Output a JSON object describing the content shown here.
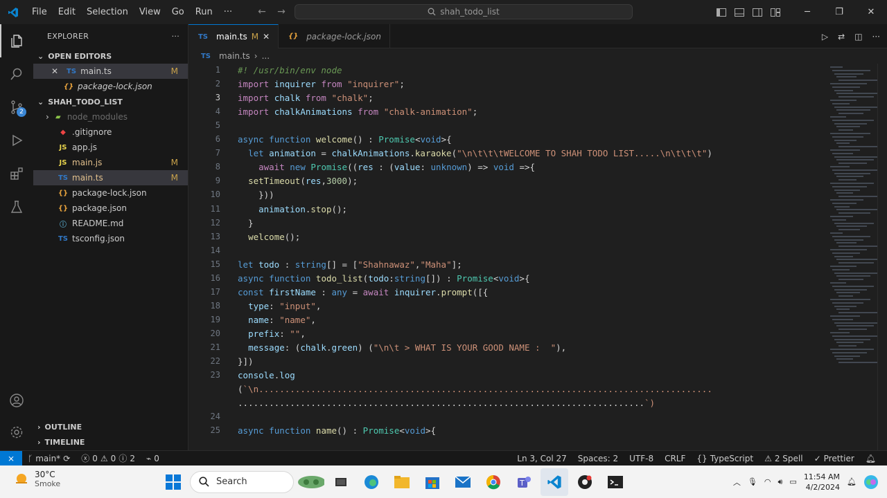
{
  "titlebar": {
    "menus": [
      "File",
      "Edit",
      "Selection",
      "View",
      "Go",
      "Run",
      "···"
    ],
    "search_text": "shah_todo_list"
  },
  "sidebar": {
    "header": "EXPLORER",
    "open_editors_label": "OPEN EDITORS",
    "open_editors": [
      {
        "name": "main.ts",
        "badge": "M",
        "icon": "TS"
      },
      {
        "name": "package-lock.json",
        "badge": "",
        "icon": ""
      }
    ],
    "project_label": "SHAH_TODO_LIST",
    "files": [
      {
        "name": "node_modules",
        "badge": "",
        "icon": "folder"
      },
      {
        "name": ".gitignore",
        "badge": "",
        "icon": "git"
      },
      {
        "name": "app.js",
        "badge": "",
        "icon": "JS"
      },
      {
        "name": "main.js",
        "badge": "M",
        "icon": "JS"
      },
      {
        "name": "main.ts",
        "badge": "M",
        "icon": "TS"
      },
      {
        "name": "package-lock.json",
        "badge": "",
        "icon": "json"
      },
      {
        "name": "package.json",
        "badge": "",
        "icon": "json"
      },
      {
        "name": "README.md",
        "badge": "",
        "icon": "md"
      },
      {
        "name": "tsconfig.json",
        "badge": "",
        "icon": "TS"
      }
    ],
    "outline_label": "OUTLINE",
    "timeline_label": "TIMELINE"
  },
  "tabs": [
    {
      "label": "main.ts",
      "badge": "M",
      "icon": "TS",
      "active": true
    },
    {
      "label": "package-lock.json",
      "badge": "",
      "icon": "json",
      "active": false
    }
  ],
  "breadcrumb": {
    "file": "main.ts",
    "rest": "..."
  },
  "code_lines": [
    {
      "n": "1",
      "text": "#! /usr/bin/env node"
    },
    {
      "n": "2",
      "text": "import inquirer from \"inquirer\";"
    },
    {
      "n": "3",
      "text": "import chalk from \"chalk\";"
    },
    {
      "n": "4",
      "text": "import chalkAnimations from \"chalk-animation\";"
    },
    {
      "n": "5",
      "text": ""
    },
    {
      "n": "6",
      "text": "async function welcome() : Promise<void>{"
    },
    {
      "n": "7",
      "text": "  let animation = chalkAnimations.karaoke(\"\\n\\t\\t\\tWELCOME TO SHAH TODO LIST.....\\n\\t\\t\\t\")"
    },
    {
      "n": "8",
      "text": "    await new Promise((res : (value: unknown) => void =>{"
    },
    {
      "n": "9",
      "text": "  setTimeout(res,3000);"
    },
    {
      "n": "10",
      "text": "    }))"
    },
    {
      "n": "11",
      "text": "    animation.stop();"
    },
    {
      "n": "12",
      "text": "  }"
    },
    {
      "n": "13",
      "text": "  welcome();"
    },
    {
      "n": "14",
      "text": ""
    },
    {
      "n": "15",
      "text": "let todo : string[] = [\"Shahnawaz\",\"Maha\"];"
    },
    {
      "n": "16",
      "text": "async function todo_list(todo:string[]) : Promise<void>{"
    },
    {
      "n": "17",
      "text": "const firstName : any = await inquirer.prompt([{"
    },
    {
      "n": "18",
      "text": "  type: \"input\","
    },
    {
      "n": "19",
      "text": "  name: \"name\","
    },
    {
      "n": "20",
      "text": "  prefix: \"\","
    },
    {
      "n": "21",
      "text": "  message: (chalk.green) (\"\\n\\t > WHAT IS YOUR GOOD NAME :  \"),"
    },
    {
      "n": "22",
      "text": "}])"
    },
    {
      "n": "23",
      "text": "console.log"
    },
    {
      "n": "",
      "text": "(`\\n......................................................................................."
    },
    {
      "n": "",
      "text": "..............................................................................`)"
    },
    {
      "n": "24",
      "text": ""
    },
    {
      "n": "25",
      "text": "async function name() : Promise<void>{"
    }
  ],
  "status": {
    "branch": "main*",
    "problems": "0",
    "warnings": "0",
    "info": "2",
    "ports": "0",
    "position": "Ln 3, Col 27",
    "spaces": "Spaces: 2",
    "encoding": "UTF-8",
    "eol": "CRLF",
    "language": "TypeScript",
    "spell": "2 Spell",
    "formatter": "Prettier"
  },
  "taskbar": {
    "temp": "30°C",
    "weather": "Smoke",
    "search": "Search",
    "time": "11:54 AM",
    "date": "4/2/2024"
  },
  "colors": {
    "accent": "#0078d4",
    "keyword": "#569cd6",
    "string": "#ce9178",
    "function": "#dcdcaa"
  }
}
